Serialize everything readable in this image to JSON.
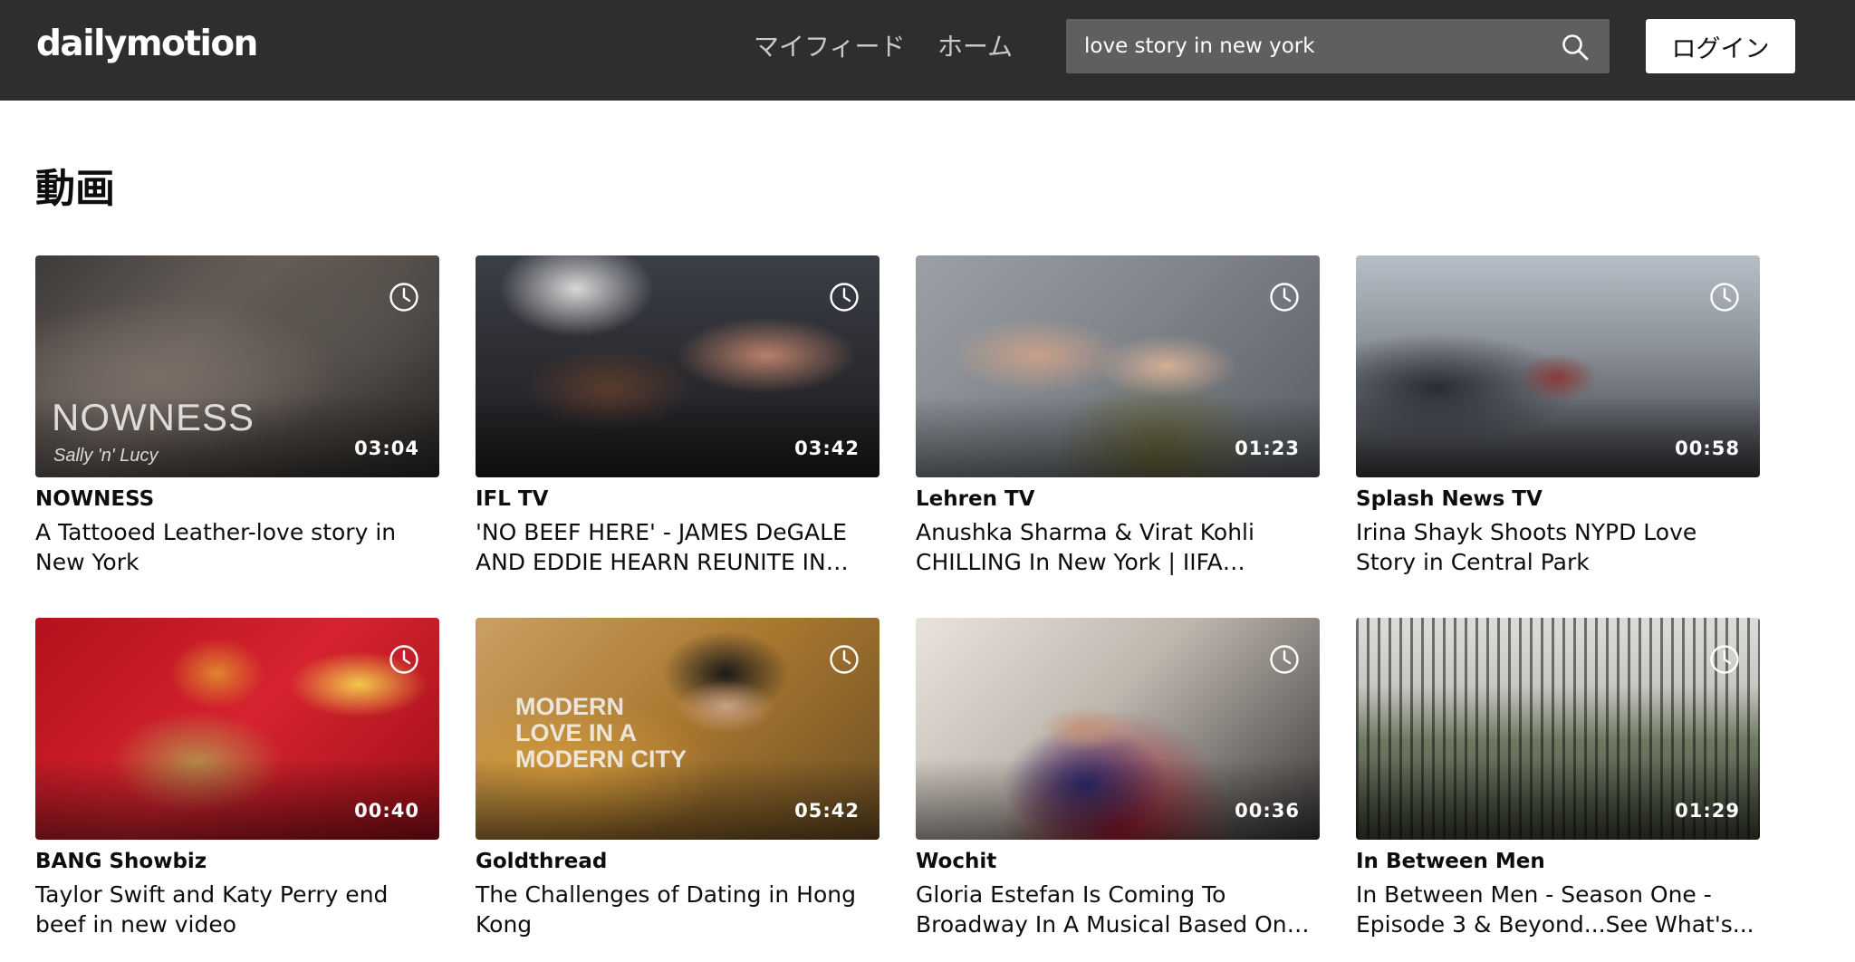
{
  "header": {
    "logo": "dailymotion",
    "nav": [
      {
        "label": "マイフィード"
      },
      {
        "label": "ホーム"
      }
    ],
    "search": {
      "value": "love story in new york",
      "icon": "search-icon"
    },
    "login_label": "ログイン"
  },
  "section": {
    "title": "動画"
  },
  "videos": [
    {
      "channel": "NOWNESS",
      "title": "A Tattooed Leather-love story in New York",
      "duration": "03:04",
      "overlay_logo": "NOWNESS",
      "overlay_caption": "Sally 'n' Lucy"
    },
    {
      "channel": "IFL TV",
      "title": "'NO BEEF HERE' - JAMES DeGALE AND EDDIE HEARN REUNITE IN NE...",
      "duration": "03:42"
    },
    {
      "channel": "Lehren TV",
      "title": "Anushka Sharma & Virat Kohli CHILLING In New York | IIFA Awards...",
      "duration": "01:23"
    },
    {
      "channel": "Splash News TV",
      "title": "Irina Shayk Shoots NYPD Love Story in Central Park",
      "duration": "00:58"
    },
    {
      "channel": "BANG Showbiz",
      "title": "Taylor Swift and Katy Perry end beef in new video",
      "duration": "00:40"
    },
    {
      "channel": "Goldthread",
      "title": "The Challenges of Dating in Hong Kong",
      "duration": "05:42",
      "overlay_text": "MODERN LOVE IN A MODERN CITY"
    },
    {
      "channel": "Wochit",
      "title": "Gloria Estefan Is Coming To Broadway In A Musical Based On Her Life An...",
      "duration": "00:36"
    },
    {
      "channel": "In Between Men",
      "title": "In Between Men - Season One - Episode 3 & Beyond...See What's...",
      "duration": "01:29"
    }
  ],
  "colors": {
    "header_bg": "#2e2e2e",
    "search_bg": "#5f5f5f",
    "text": "#0d0d0d"
  }
}
